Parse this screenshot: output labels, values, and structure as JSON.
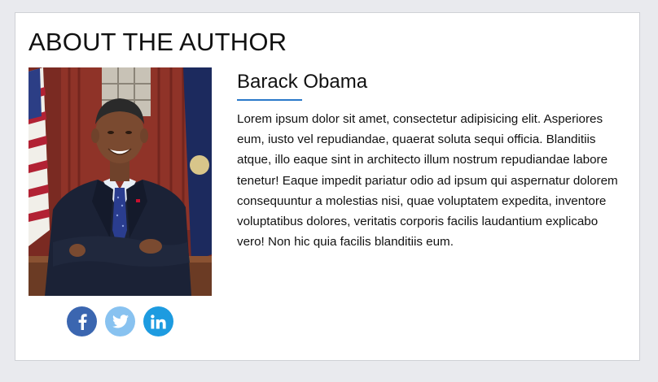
{
  "section": {
    "title": "ABOUT THE AUTHOR"
  },
  "author": {
    "name": "Barack Obama",
    "bio": "Lorem ipsum dolor sit amet, consectetur adipisicing elit. Asperiores eum, iusto vel repudiandae, quaerat soluta sequi officia. Blanditiis atque, illo eaque sint in architecto illum nostrum repudiandae labore tenetur! Eaque impedit pariatur odio ad ipsum qui aspernatur dolorem consequuntur a molestias nisi, quae voluptatem expedita, inventore voluptatibus dolores, veritatis corporis facilis laudantium explicabo vero! Non hic quia facilis blanditiis eum."
  },
  "social": [
    {
      "icon": "facebook-icon",
      "color": "#3b66b0"
    },
    {
      "icon": "twitter-icon",
      "color": "#88c2f0"
    },
    {
      "icon": "linkedin-icon",
      "color": "#1d9be0"
    }
  ],
  "colors": {
    "accent": "#2a79c9",
    "page_background": "#e9eaee",
    "card_background": "#ffffff"
  }
}
